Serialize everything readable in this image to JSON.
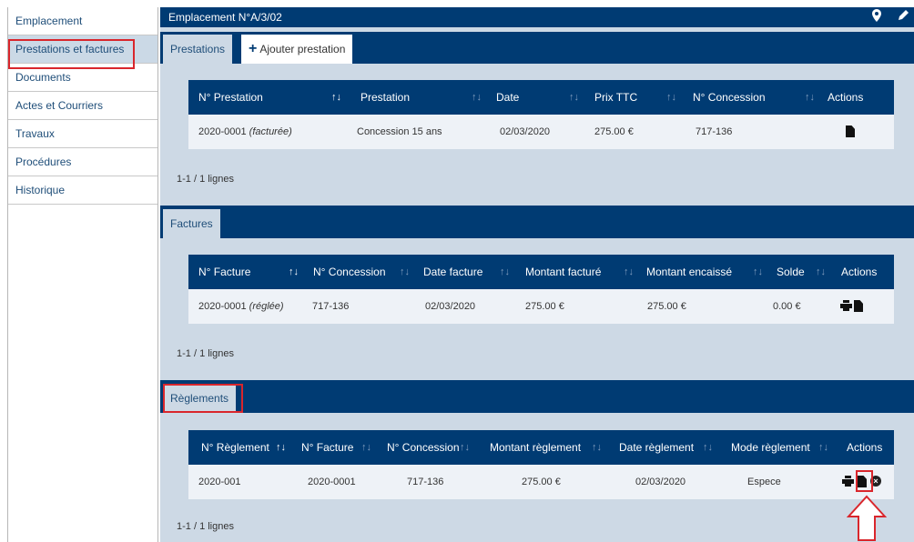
{
  "sidebar": {
    "items": [
      {
        "label": "Emplacement"
      },
      {
        "label": "Prestations et factures"
      },
      {
        "label": "Documents"
      },
      {
        "label": "Actes et Courriers"
      },
      {
        "label": "Travaux"
      },
      {
        "label": "Procédures"
      },
      {
        "label": "Historique"
      }
    ]
  },
  "header": {
    "title": "Emplacement N°A/3/02"
  },
  "prestations": {
    "tab_label": "Prestations",
    "add_label": "Ajouter prestation",
    "columns": [
      "N° Prestation",
      "Prestation",
      "Date",
      "Prix TTC",
      "N° Concession",
      "Actions"
    ],
    "row": {
      "num": "2020-0001",
      "status": "(facturée)",
      "prestation": "Concession 15 ans",
      "date": "02/03/2020",
      "prix": "275.00 €",
      "concession": "717-136"
    },
    "count": "1-1 / 1 lignes"
  },
  "factures": {
    "tab_label": "Factures",
    "columns": [
      "N° Facture",
      "N° Concession",
      "Date facture",
      "Montant facturé",
      "Montant encaissé",
      "Solde",
      "Actions"
    ],
    "row": {
      "num": "2020-0001",
      "status": "(réglée)",
      "concession": "717-136",
      "date": "02/03/2020",
      "facture": "275.00 €",
      "encaisse": "275.00 €",
      "solde": "0.00 €"
    },
    "count": "1-1 / 1 lignes"
  },
  "reglements": {
    "tab_label": "Règlements",
    "columns": [
      "N° Règlement",
      "N° Facture",
      "N° Concession",
      "Montant règlement",
      "Date règlement",
      "Mode règlement",
      "Actions"
    ],
    "row": {
      "num": "2020-001",
      "facture": "2020-0001",
      "concession": "717-136",
      "montant": "275.00 €",
      "date": "02/03/2020",
      "mode": "Espece"
    },
    "count": "1-1 / 1 lignes"
  },
  "icons": {
    "header": [
      "map-marker-icon",
      "pencil-icon"
    ]
  },
  "colors": {
    "accent": "#003b73",
    "panel": "#cdd9e5",
    "highlight": "#d9262c"
  }
}
